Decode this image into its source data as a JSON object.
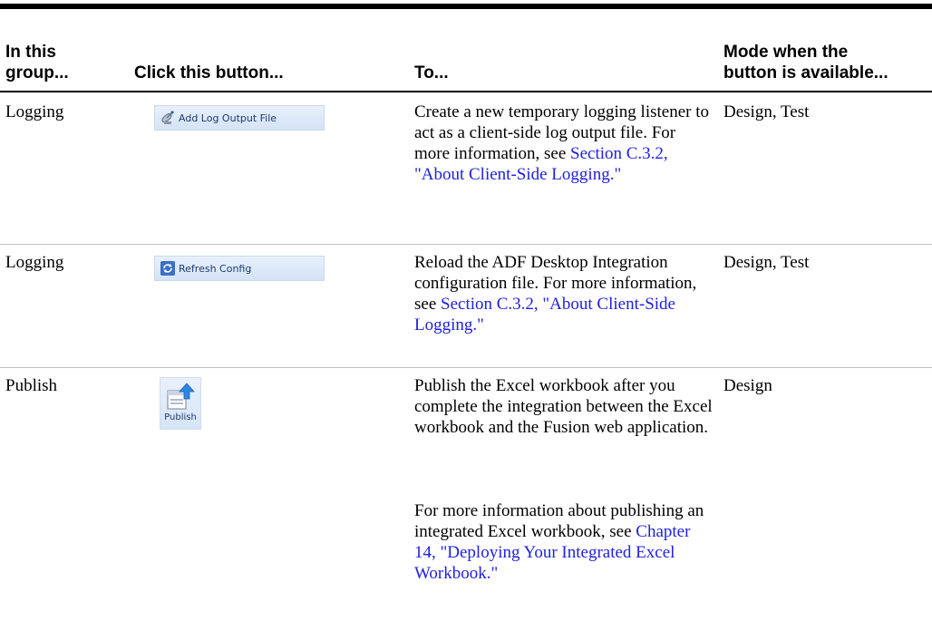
{
  "header": {
    "col1": "In this group...",
    "col2": "Click this button...",
    "col3": "To...",
    "col4": "Mode when the button is available..."
  },
  "rows": [
    {
      "group": "Logging",
      "button_label": "Add Log Output File",
      "button_icon": "satellite-dish-icon",
      "desc_text": "Create a new temporary logging listener to act as a client-side log output file. For more information, see ",
      "desc_link": "Section C.3.2, \"About Client-Side Logging.\"",
      "mode": "Design, Test"
    },
    {
      "group": "Logging",
      "button_label": "Refresh Config",
      "button_icon": "refresh-config-icon",
      "desc_text": "Reload the ADF Desktop Integration configuration file. For more information, see ",
      "desc_link": "Section C.3.2, \"About Client-Side Logging.\"",
      "mode": "Design, Test"
    },
    {
      "group": "Publish",
      "button_label": "Publish",
      "button_icon": "publish-icon",
      "desc_text": "Publish the Excel workbook after you complete the integration between the Excel workbook and the Fusion web application.",
      "desc2_text": "For more information about publishing an integrated Excel workbook, see ",
      "desc2_link": "Chapter 14, \"Deploying Your Integrated Excel Workbook.\"",
      "mode": "Design"
    }
  ],
  "colors": {
    "link": "#2020e0",
    "ribbon_text": "#1e3a6e",
    "rule": "#000000"
  }
}
